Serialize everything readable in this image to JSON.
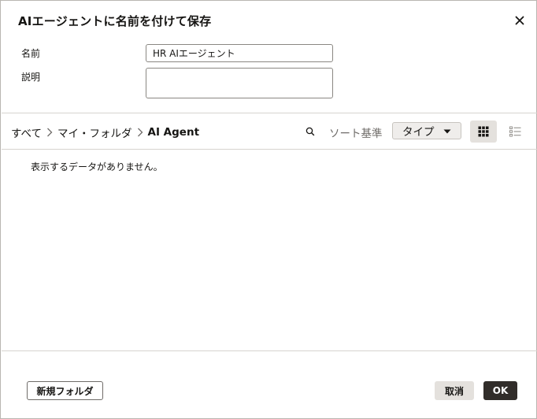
{
  "dialog": {
    "title": "AIエージェントに名前を付けて保存"
  },
  "form": {
    "name_label": "名前",
    "name_value": "HR AIエージェント",
    "description_label": "説明",
    "description_value": ""
  },
  "breadcrumb": {
    "items": [
      "すべて",
      "マイ・フォルダ",
      "AI Agent"
    ]
  },
  "toolbar": {
    "sort_label": "ソート基準",
    "sort_value": "タイプ",
    "view_mode": "grid"
  },
  "content": {
    "empty_message": "表示するデータがありません。"
  },
  "footer": {
    "new_folder_label": "新規フォルダ",
    "cancel_label": "取消",
    "ok_label": "OK"
  },
  "icons": {
    "close": "close-icon",
    "search": "search-icon",
    "chevron": "chevron-right-icon",
    "caret": "caret-down-icon",
    "grid": "grid-view-icon",
    "list": "list-view-icon"
  },
  "colors": {
    "primary_button": "#312d2a",
    "secondary_button": "#e4e1dd",
    "border": "#d6d3cf"
  }
}
